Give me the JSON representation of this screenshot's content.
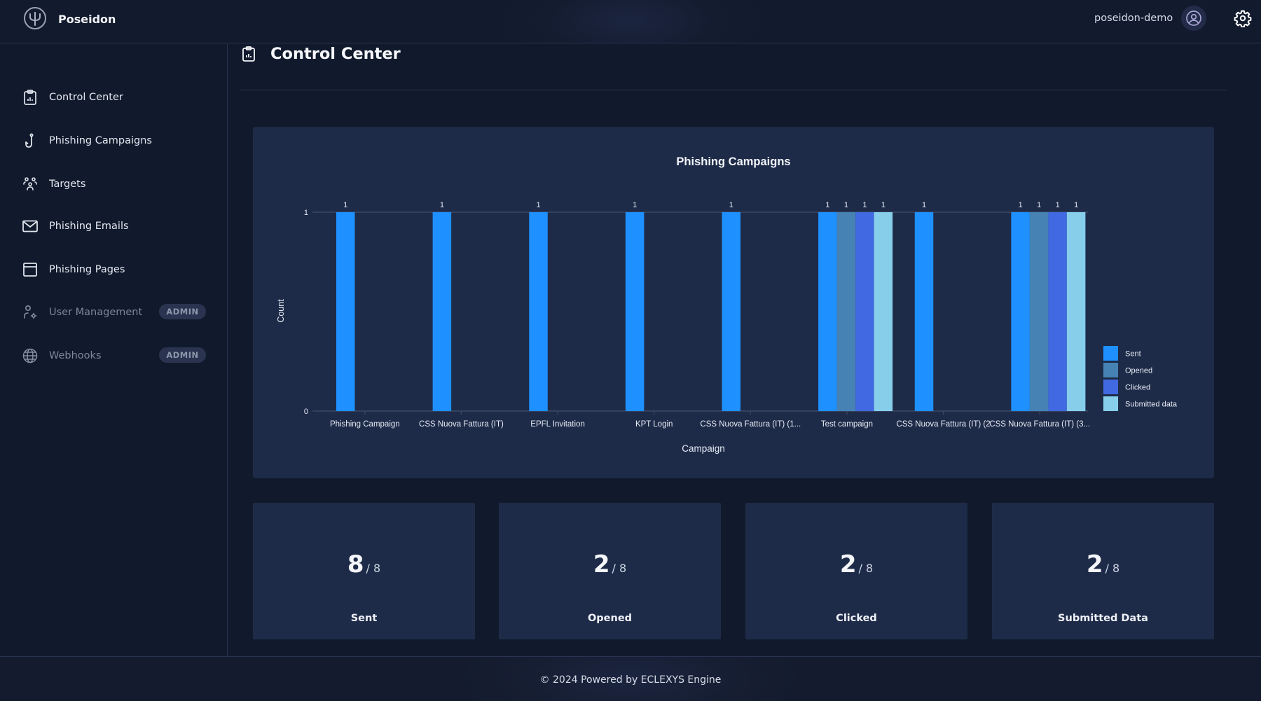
{
  "header": {
    "brand": "Poseidon",
    "logo_icon": "trident-icon",
    "username": "poseidon-demo",
    "avatar_icon": "user-circle-icon",
    "settings_icon": "gear-icon"
  },
  "sidebar": {
    "items": [
      {
        "label": "Control Center",
        "icon": "clipboard-chart-icon",
        "disabled": false
      },
      {
        "label": "Phishing Campaigns",
        "icon": "fishhook-icon",
        "disabled": false
      },
      {
        "label": "Targets",
        "icon": "users-group-icon",
        "disabled": false
      },
      {
        "label": "Phishing Emails",
        "icon": "mail-icon",
        "disabled": false
      },
      {
        "label": "Phishing Pages",
        "icon": "browser-window-icon",
        "disabled": false
      },
      {
        "label": "User Management",
        "icon": "user-settings-icon",
        "disabled": true,
        "badge": "ADMIN"
      },
      {
        "label": "Webhooks",
        "icon": "globe-icon",
        "disabled": true,
        "badge": "ADMIN"
      }
    ]
  },
  "page": {
    "title": "Control Center",
    "title_icon": "clipboard-chart-icon"
  },
  "chart_data": {
    "type": "bar",
    "title": "Phishing Campaigns",
    "xlabel": "Campaign",
    "ylabel": "Count",
    "ylim": [
      0,
      1
    ],
    "yticks": [
      "0",
      "1"
    ],
    "grid": true,
    "legend_position": "right",
    "categories": [
      "Phishing Campaign",
      "CSS Nuova Fattura (IT)",
      "EPFL Invitation",
      "KPT Login",
      "CSS Nuova Fattura (IT) (1...",
      "Test campaign",
      "CSS Nuova Fattura (IT) (2",
      "CSS Nuova Fattura (IT) (3..."
    ],
    "series": [
      {
        "name": "Sent",
        "color": "#1e90ff",
        "values": [
          1,
          1,
          1,
          1,
          1,
          1,
          1,
          1
        ]
      },
      {
        "name": "Opened",
        "color": "#4682b4",
        "values": [
          0,
          0,
          0,
          0,
          0,
          1,
          0,
          1
        ]
      },
      {
        "name": "Clicked",
        "color": "#4169e1",
        "values": [
          0,
          0,
          0,
          0,
          0,
          1,
          0,
          1
        ]
      },
      {
        "name": "Submitted data",
        "color": "#87ceeb",
        "values": [
          0,
          0,
          0,
          0,
          0,
          1,
          0,
          1
        ]
      }
    ]
  },
  "stats": [
    {
      "value": "8",
      "total": "/ 8",
      "label": "Sent"
    },
    {
      "value": "2",
      "total": "/ 8",
      "label": "Opened"
    },
    {
      "value": "2",
      "total": "/ 8",
      "label": "Clicked"
    },
    {
      "value": "2",
      "total": "/ 8",
      "label": "Submitted Data"
    }
  ],
  "footer": {
    "text": "© 2024 Powered by ECLEXYS Engine"
  }
}
